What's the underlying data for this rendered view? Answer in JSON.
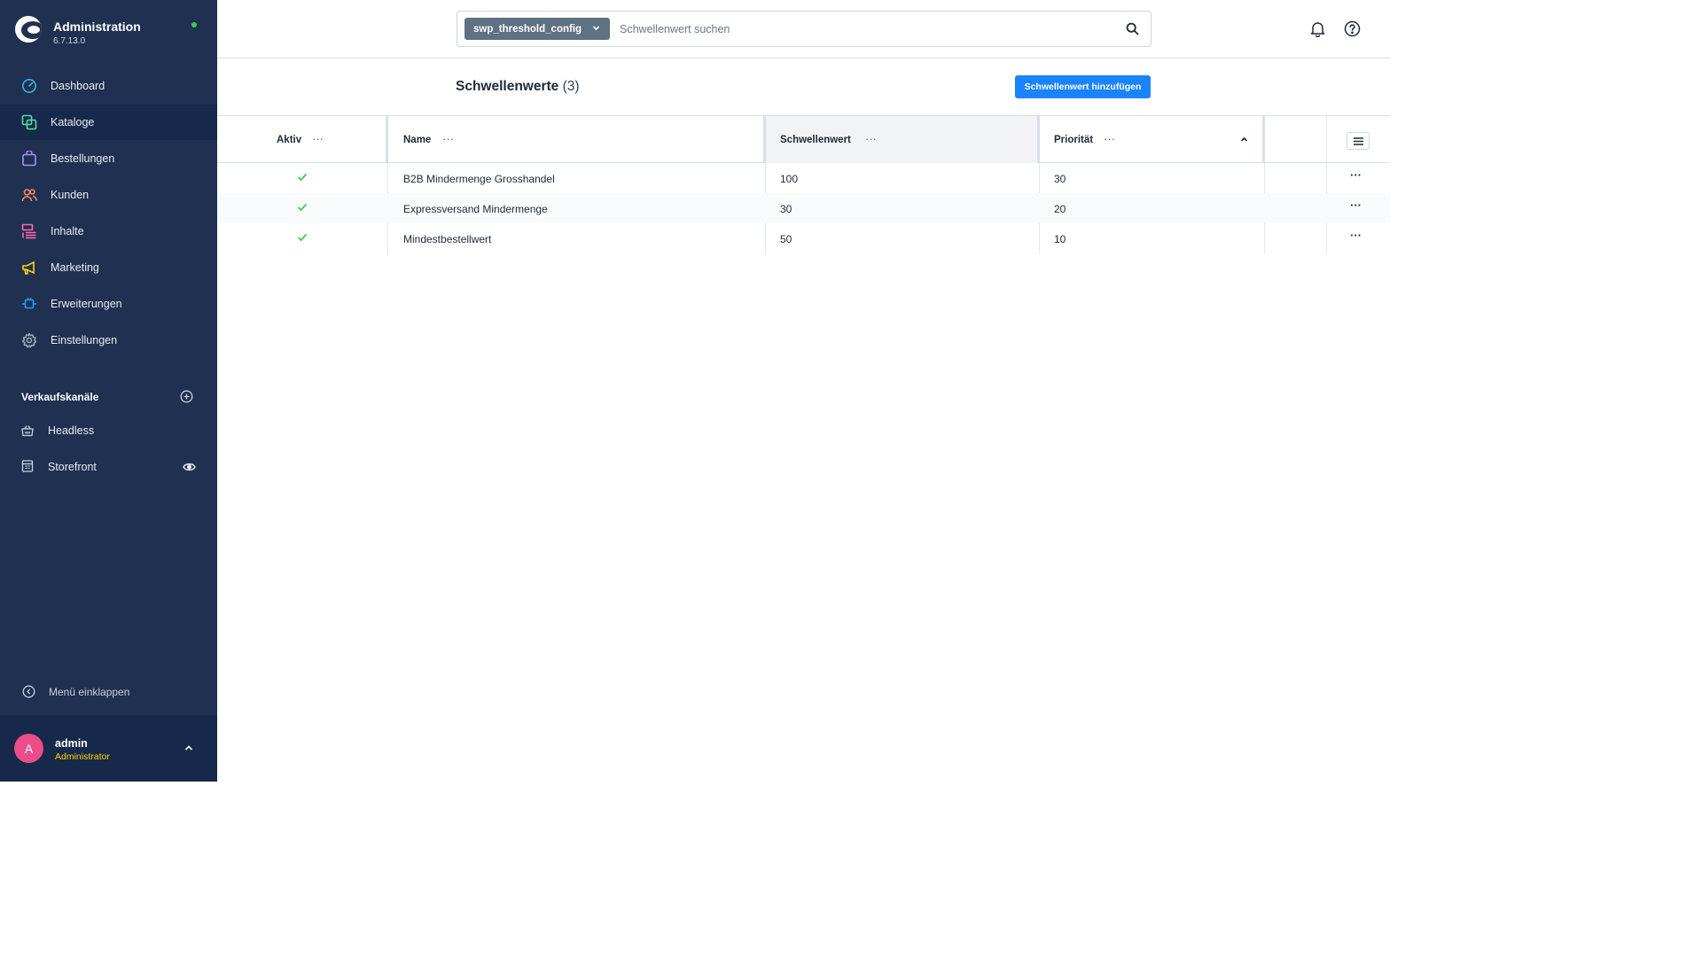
{
  "app": {
    "title": "Administration",
    "version": "6.7.13.0",
    "status_color": "#37d046"
  },
  "sidebar": {
    "items": [
      {
        "label": "Dashboard",
        "icon": "dashboard-gauge-icon",
        "color": "#37b3e6",
        "active": false
      },
      {
        "label": "Kataloge",
        "icon": "catalog-icon",
        "color": "#57d9a3",
        "active": true
      },
      {
        "label": "Bestellungen",
        "icon": "shopping-bag-icon",
        "color": "#a092f0",
        "active": false
      },
      {
        "label": "Kunden",
        "icon": "customers-icon",
        "color": "#f88962",
        "active": false
      },
      {
        "label": "Inhalte",
        "icon": "content-icon",
        "color": "#ff68b4",
        "active": false
      },
      {
        "label": "Marketing",
        "icon": "megaphone-icon",
        "color": "#ffd700",
        "active": false
      },
      {
        "label": "Erweiterungen",
        "icon": "plugin-icon",
        "color": "#189eff",
        "active": false
      },
      {
        "label": "Einstellungen",
        "icon": "gear-icon",
        "color": "#9aa8b5",
        "active": false
      }
    ],
    "sales_channels_title": "Verkaufskanäle",
    "sales_channels": [
      {
        "label": "Headless",
        "icon": "basket-icon"
      },
      {
        "label": "Storefront",
        "icon": "storefront-icon",
        "has_eye": true
      }
    ],
    "collapse_label": "Menü einklappen",
    "user": {
      "initial": "A",
      "name": "admin",
      "role": "Administrator",
      "avatar_color": "#ec4c8a"
    }
  },
  "search": {
    "type_label": "swp_threshold_config",
    "placeholder": "Schwellenwert suchen",
    "value": ""
  },
  "header": {
    "title": "Schwellenwerte",
    "count": "(3)",
    "add_button_label": "Schwellenwert hinzufügen",
    "accent_color": "#1a83ff"
  },
  "grid": {
    "columns": [
      {
        "label": "Aktiv",
        "key": "active"
      },
      {
        "label": "Name",
        "key": "name"
      },
      {
        "label": "Schwellenwert",
        "key": "threshold",
        "highlighted": true
      },
      {
        "label": "Priorität",
        "key": "priority",
        "sort": "ascending"
      }
    ],
    "rows": [
      {
        "active": true,
        "name": "B2B Mindermenge Grosshandel",
        "threshold": "100",
        "priority": "30"
      },
      {
        "active": true,
        "name": "Expressversand Mindermenge",
        "threshold": "30",
        "priority": "20"
      },
      {
        "active": true,
        "name": "Mindestbestellwert",
        "threshold": "50",
        "priority": "10"
      }
    ],
    "column_menu_glyph": "···",
    "row_menu_glyph": "···"
  }
}
